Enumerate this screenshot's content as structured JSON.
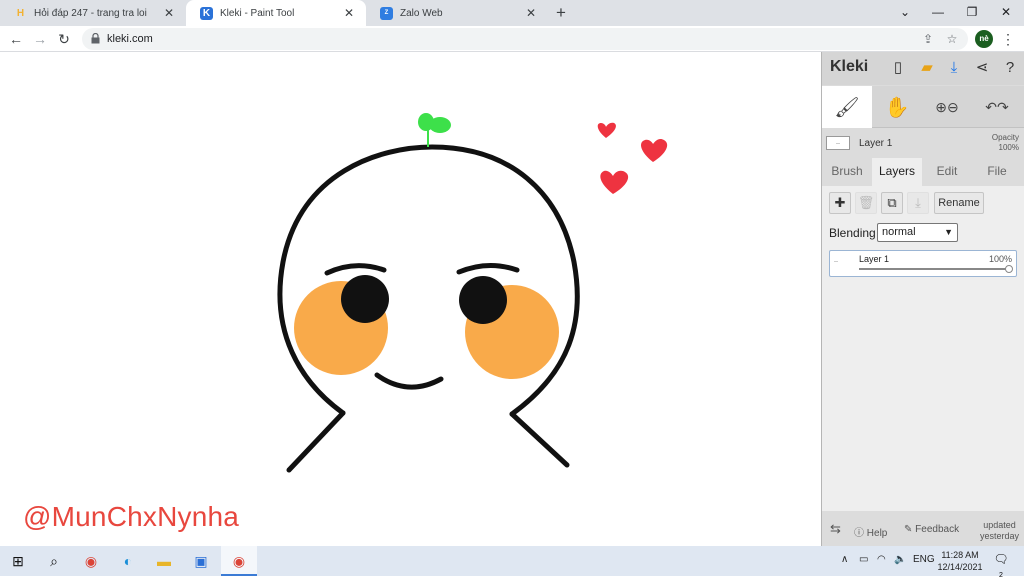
{
  "browser": {
    "tabs": [
      {
        "title": "Hỏi đáp 247 - trang tra loi",
        "icon": "hoidap-favicon",
        "active": false
      },
      {
        "title": "Kleki - Paint Tool",
        "icon": "kleki-favicon",
        "active": true
      },
      {
        "title": "Zalo Web",
        "icon": "zalo-favicon",
        "active": false
      }
    ],
    "new_tab": "+",
    "url": "kleki.com",
    "profile_initials": "nè"
  },
  "canvas": {
    "watermark": "@MunChxNynha",
    "watermark_color": "#e8473e",
    "blush_color": "#f9aa4a",
    "heart_color": "#ee3340",
    "sprout_color": "#3de04a"
  },
  "kleki": {
    "logo": "Kleki",
    "current_layer": "Layer 1",
    "opacity_label": "Opacity",
    "opacity_value": "100%",
    "panel_tabs": [
      "Brush",
      "Layers",
      "Edit",
      "File"
    ],
    "active_tab": "Layers",
    "rename_label": "Rename",
    "blending_label": "Blending",
    "blending_value": "normal",
    "layers": [
      {
        "name": "Layer 1",
        "opacity": "100%",
        "opacity_fraction": 1.0
      }
    ],
    "footer": {
      "help": "Help",
      "feedback": "Feedback",
      "updated_line1": "updated",
      "updated_line2": "yesterday"
    }
  },
  "taskbar": {
    "language": "ENG",
    "time": "11:28 AM",
    "date": "12/14/2021",
    "notification_count": "2"
  }
}
